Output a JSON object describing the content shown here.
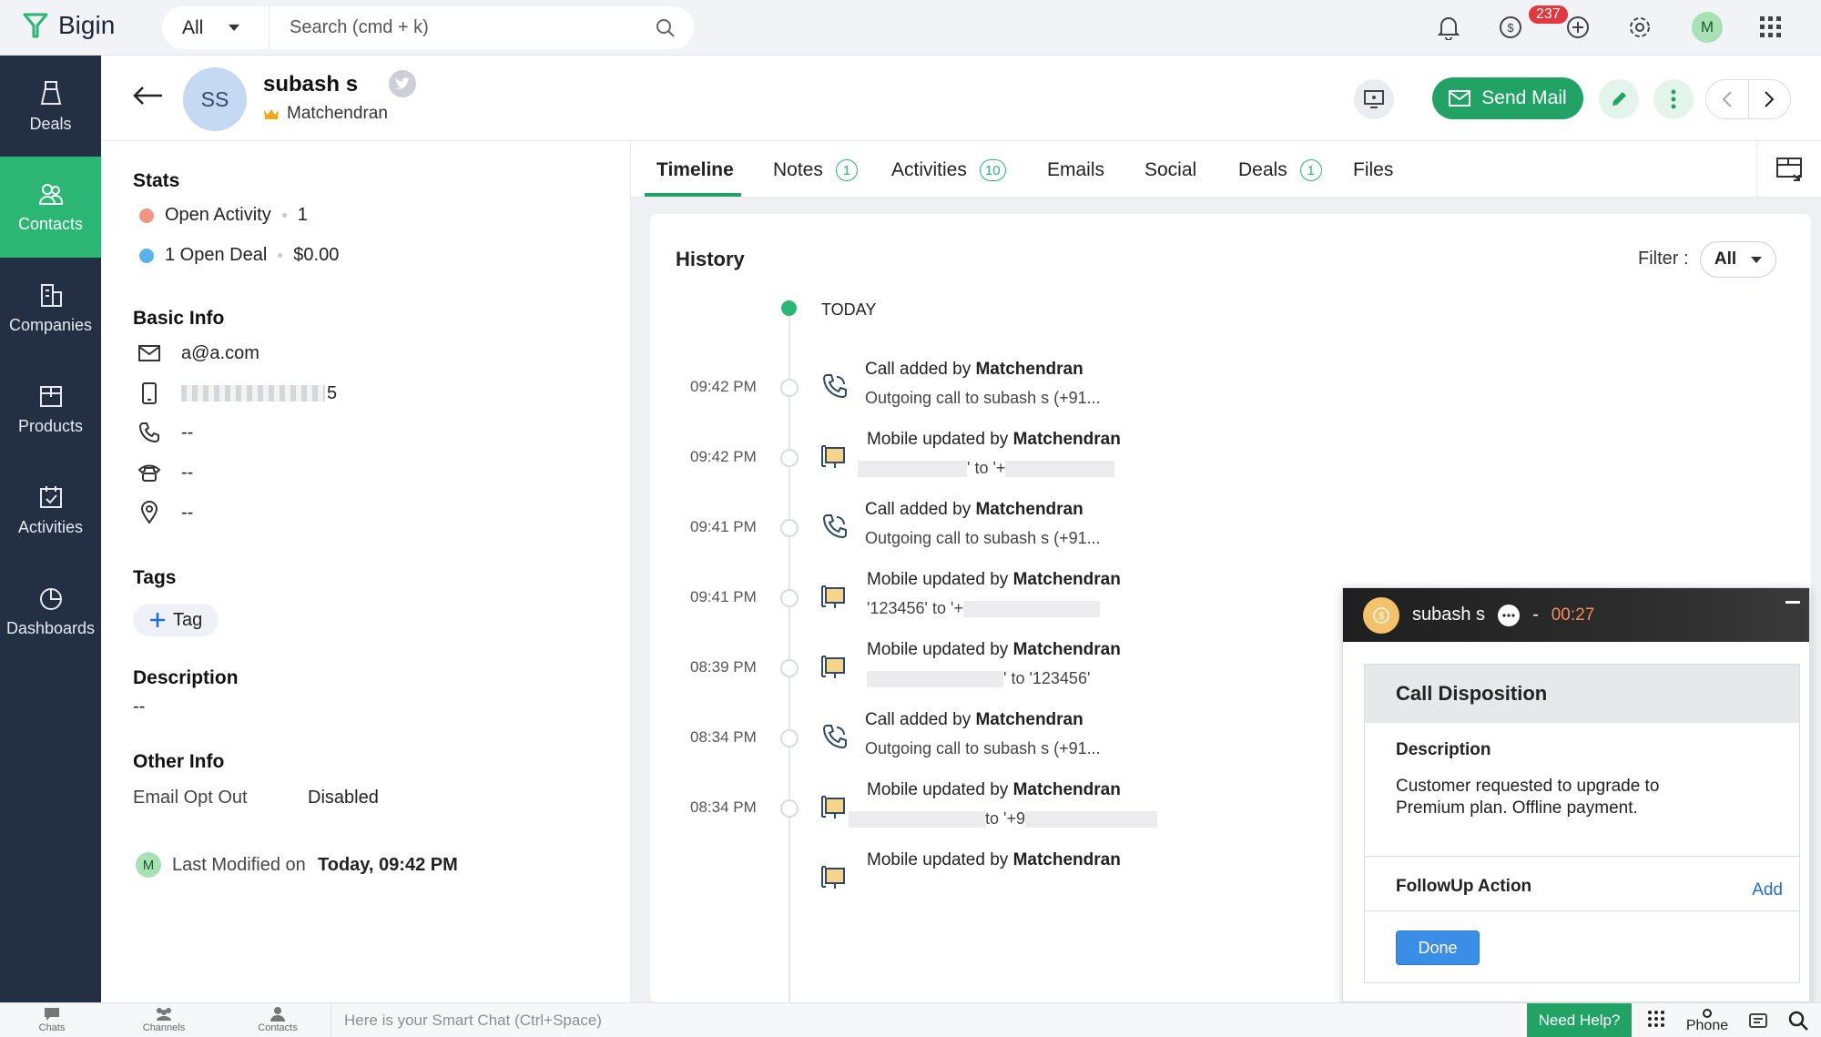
{
  "app": {
    "name": "Bigin"
  },
  "search": {
    "scope": "All",
    "placeholder": "Search (cmd + k)"
  },
  "topbar": {
    "notification_count": "237",
    "user_initial": "M"
  },
  "sidebar": {
    "items": [
      {
        "label": "Deals",
        "icon": "deals-icon"
      },
      {
        "label": "Contacts",
        "icon": "contacts-icon"
      },
      {
        "label": "Companies",
        "icon": "companies-icon"
      },
      {
        "label": "Products",
        "icon": "products-icon"
      },
      {
        "label": "Activities",
        "icon": "activities-icon"
      },
      {
        "label": "Dashboards",
        "icon": "dashboards-icon"
      }
    ],
    "active": "Contacts"
  },
  "contact": {
    "initials": "SS",
    "name": "subash s",
    "owner": "Matchendran"
  },
  "header": {
    "send_mail": "Send Mail"
  },
  "stats": {
    "title": "Stats",
    "open_activity_label": "Open Activity",
    "open_activity_count": "1",
    "open_deal_label": "1 Open Deal",
    "open_deal_value": "$0.00"
  },
  "basic_info": {
    "title": "Basic Info",
    "email": "a@a.com",
    "mobile_tail": "5",
    "phone": "--",
    "home_phone": "--",
    "address": "--"
  },
  "tags": {
    "title": "Tags",
    "add_label": "Tag"
  },
  "description": {
    "title": "Description",
    "value": "--"
  },
  "other_info": {
    "title": "Other Info",
    "email_opt_out_label": "Email Opt Out",
    "email_opt_out_value": "Disabled"
  },
  "last_modified": {
    "initial": "M",
    "label": "Last Modified on",
    "value": "Today, 09:42 PM"
  },
  "tabs": [
    {
      "label": "Timeline",
      "count": ""
    },
    {
      "label": "Notes",
      "count": "1"
    },
    {
      "label": "Activities",
      "count": "10"
    },
    {
      "label": "Emails",
      "count": ""
    },
    {
      "label": "Social",
      "count": ""
    },
    {
      "label": "Deals",
      "count": "1"
    },
    {
      "label": "Files",
      "count": ""
    }
  ],
  "history": {
    "title": "History",
    "filter_label": "Filter :",
    "filter_value": "All",
    "today_label": "TODAY",
    "entries": [
      {
        "time": "09:42 PM",
        "type": "call",
        "action": "Call added by",
        "user": "Matchendran",
        "sub": "Outgoing call to subash s (+91..."
      },
      {
        "time": "09:42 PM",
        "type": "mobile",
        "action": "Mobile updated by",
        "user": "Matchendran",
        "sub_mid": "' to '+"
      },
      {
        "time": "09:41 PM",
        "type": "call",
        "action": "Call added by",
        "user": "Matchendran",
        "sub": "Outgoing call to subash s (+91..."
      },
      {
        "time": "09:41 PM",
        "type": "mobile",
        "action": "Mobile updated by",
        "user": "Matchendran",
        "sub_prefix": "'123456' to '+"
      },
      {
        "time": "08:39 PM",
        "type": "mobile",
        "action": "Mobile updated by",
        "user": "Matchendran",
        "sub_suffix": "' to '123456'"
      },
      {
        "time": "08:34 PM",
        "type": "call",
        "action": "Call added by",
        "user": "Matchendran",
        "sub": "Outgoing call to subash s (+91..."
      },
      {
        "time": "08:34 PM",
        "type": "mobile",
        "action": "Mobile updated by",
        "user": "Matchendran",
        "sub_mid": "to '+9"
      },
      {
        "time": "",
        "type": "mobile",
        "action": "Mobile updated by",
        "user": "Matchendran"
      }
    ]
  },
  "call_widget": {
    "name": "subash s",
    "separator": "-",
    "timer": "00:27",
    "disposition_title": "Call Disposition",
    "description_label": "Description",
    "description_text": "Customer requested to upgrade to Premium plan. Offline payment.",
    "followup_label": "FollowUp Action",
    "add_label": "Add",
    "done_label": "Done"
  },
  "bottombar": {
    "chats": "Chats",
    "channels": "Channels",
    "contacts": "Contacts",
    "smart_chat_placeholder": "Here is your Smart Chat (Ctrl+Space)",
    "need_help": "Need Help?",
    "phone": "Phone"
  },
  "colors": {
    "accent": "#21a366",
    "sidebar": "#233044",
    "active_nav": "#2bb673",
    "badge": "#e0383e"
  }
}
